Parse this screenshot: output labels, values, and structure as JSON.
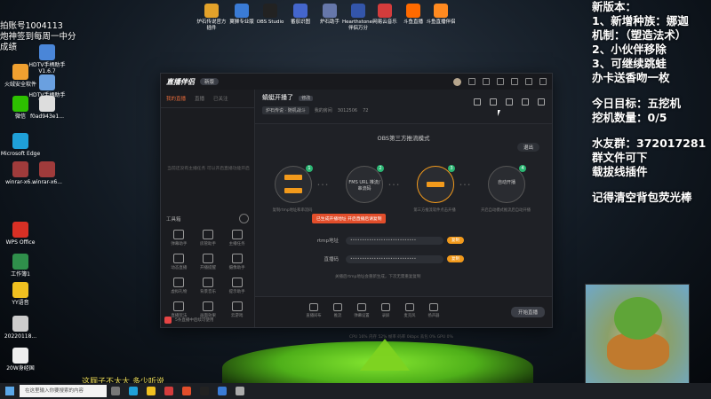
{
  "overlay_left": {
    "line1": "拍账号1004113",
    "line2": "炮神签到每周一中分",
    "line3": "成绩"
  },
  "desktop_top_icons": [
    {
      "label": "炉石传说官方插件",
      "color": "#e3a22a"
    },
    {
      "label": "翼狮专业版",
      "color": "#3a7bd5"
    },
    {
      "label": "OBS Studio",
      "color": "#222222"
    },
    {
      "label": "番茄识图",
      "color": "#4466cc"
    },
    {
      "label": "炉石助手",
      "color": "#6677aa"
    },
    {
      "label": "Hearthstone-伴侣万分",
      "color": "#3355aa"
    },
    {
      "label": "网易云音乐",
      "color": "#d43c3c"
    },
    {
      "label": "斗鱼直播",
      "color": "#ff6a00"
    },
    {
      "label": "斗鱼直播伴侣",
      "color": "#ff8a20"
    }
  ],
  "desktop_left_icons": [
    {
      "label": "HDTV手柄助手V1.6.7",
      "color": "#4a86d8"
    },
    {
      "label": "火绒安全软件",
      "color": "#f0a030"
    },
    {
      "label": "HDTV手柄助手V1.6.7",
      "color": "#6aa0e0"
    },
    {
      "label": "微信",
      "color": "#2dc100"
    },
    {
      "label": "f0ad943e1...",
      "color": "#dddddd"
    },
    {
      "label": "Microsoft Edge",
      "color": "#1fa0d8"
    },
    {
      "label": "winrar-x6...",
      "color": "#a03b3b"
    },
    {
      "label": "winrar-x6...",
      "color": "#a03b3b"
    },
    {
      "label": "WPS Office",
      "color": "#d93025"
    },
    {
      "label": "工作簿1",
      "color": "#2f8f4b"
    },
    {
      "label": "YY语音",
      "color": "#f0c020"
    },
    {
      "label": "20220118...",
      "color": "#cccccc"
    },
    {
      "label": "20W身经国",
      "color": "#eeeeee"
    }
  ],
  "overlay_right": {
    "lines_a": [
      "新版本：",
      "1、新增种族：娜迦",
      "机制：（塑造法术）",
      "2、小伙伴移除",
      "3、可继续跳蛙",
      "办卡送香吻一枚"
    ],
    "lines_b": [
      "今日目标：五挖机",
      "挖机数量：0/5"
    ],
    "lines_c": [
      "水友群：372017281",
      "群文件可下",
      "载拔线插件"
    ],
    "lines_d": [
      "记得清空背包荧光棒"
    ]
  },
  "bottom_caption": "这厕子不太大 多少听说",
  "app": {
    "logo": "直播伴侣",
    "version": "新版",
    "left_tabs": [
      "我的直播",
      "直播",
      "已关注"
    ],
    "left_empty": "当前还没有主播任务 可以开启直播功能开启",
    "tools_title": "工具箱",
    "tools": [
      "弹幕助手",
      "房管助手",
      "主播任务",
      "动态直播",
      "开播提醒",
      "摄像助手",
      "虚拟礼物",
      "背景音乐",
      "提示助手",
      "直播玩法",
      "画面效果",
      "云游戏"
    ],
    "footer_text": "5条直播中后续可使用",
    "room_title": "蜻蜓开播了",
    "room_tag": "修改",
    "category": "炉石传说 · 随机战斗",
    "room_label": "我的房间",
    "room_id": "3012506",
    "viewers": "72",
    "obs_mode": "OBS第三方推流模式",
    "exit_label": "退出",
    "steps": [
      {
        "num": "1",
        "label": "复制",
        "desc": "复制rtmp地址和串流码"
      },
      {
        "num": "2",
        "label": "FMS URL 推流/串流码",
        "desc": ""
      },
      {
        "num": "3",
        "label": "开始推流",
        "desc": "第三方推流软件点击开播"
      },
      {
        "num": "4",
        "label": "自动开播",
        "desc": "开启自动模式推流后自动开播"
      }
    ],
    "red_notice": "已生成开播地址 开启直播后请复制",
    "rtmp_label": "rtmp地址",
    "rtmp_value": "••••••••••••••••••••••••••••",
    "key_label": "直播码",
    "key_value": "••••••••••••••••••••••••••••",
    "copy_label": "复制",
    "hint": "关播后rtmp地址会重新生成，下次无需重复复制",
    "bottom_tools": [
      "直播间布",
      "推流",
      "弹幕设置",
      "录屏",
      "麦克风",
      "扬声器"
    ],
    "start_label": "开始直播",
    "status": "CPU 16%  内存 52%  帧率  码率 0kbps  丢包 0%  GPU 0%"
  },
  "taskbar": {
    "search_placeholder": "在这里输入你要搜索的内容",
    "time": "",
    "date": ""
  }
}
